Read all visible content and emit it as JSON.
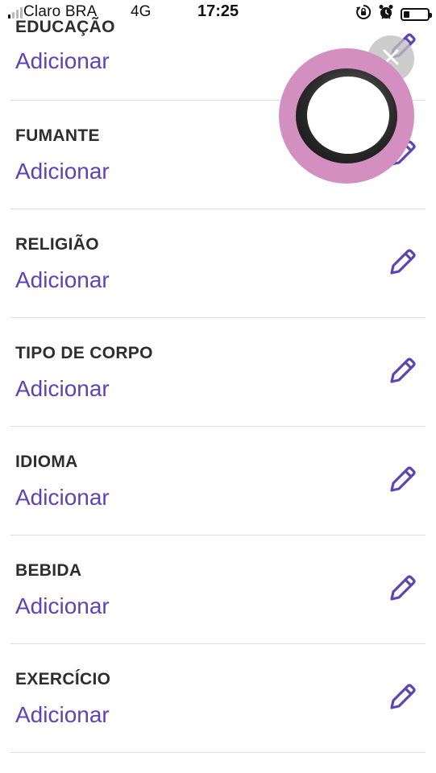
{
  "status_bar": {
    "carrier": "Claro BRA",
    "network": "4G",
    "time": "17:25",
    "battery_level": 0.25
  },
  "profile_fields": [
    {
      "label": "EDUCAÇÃO",
      "value": "Adicionar"
    },
    {
      "label": "FUMANTE",
      "value": "Adicionar"
    },
    {
      "label": "RELIGIÃO",
      "value": "Adicionar"
    },
    {
      "label": "TIPO DE CORPO",
      "value": "Adicionar"
    },
    {
      "label": "IDIOMA",
      "value": "Adicionar"
    },
    {
      "label": "BEBIDA",
      "value": "Adicionar"
    },
    {
      "label": "EXERCÍCIO",
      "value": "Adicionar"
    }
  ],
  "icons": {
    "edit": "pencil-icon",
    "close": "close-icon",
    "rotation_lock": "rotation-lock-icon",
    "alarm": "alarm-icon"
  },
  "colors": {
    "accent": "#5b44b5",
    "label": "#2d2d2d",
    "divider": "#dedede",
    "bubble_ring": "#d28fbf"
  }
}
